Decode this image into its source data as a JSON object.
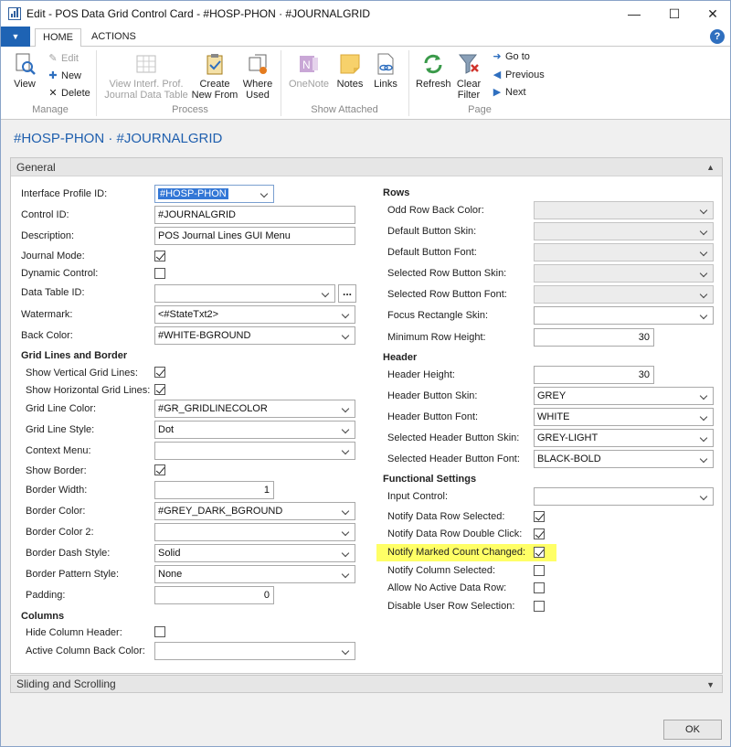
{
  "window": {
    "title": "Edit - POS Data Grid Control Card - #HOSP-PHON · #JOURNALGRID",
    "minimize": "—",
    "maximize": "☐",
    "close": "✕"
  },
  "ribbon_tabs": [
    "HOME",
    "ACTIONS"
  ],
  "ribbon": {
    "manage": {
      "label": "Manage",
      "view": "View",
      "edit": "Edit",
      "new": "New",
      "delete": "Delete"
    },
    "process": {
      "label": "Process",
      "view_interf": "View Interf. Prof.",
      "view_interf2": "Journal Data Table",
      "create": "Create",
      "create2": "New From",
      "where": "Where",
      "where2": "Used"
    },
    "show_attached": {
      "label": "Show Attached",
      "onenote": "OneNote",
      "notes": "Notes",
      "links": "Links"
    },
    "page": {
      "label": "Page",
      "refresh": "Refresh",
      "clear": "Clear",
      "clear2": "Filter",
      "goto": "Go to",
      "previous": "Previous",
      "next": "Next"
    }
  },
  "page_title": "#HOSP-PHON · #JOURNALGRID",
  "general": {
    "header": "General",
    "left": {
      "interface_profile_id": {
        "label": "Interface Profile ID:",
        "value": "#HOSP-PHON"
      },
      "control_id": {
        "label": "Control ID:",
        "value": "#JOURNALGRID"
      },
      "description": {
        "label": "Description:",
        "value": "POS Journal Lines GUI Menu"
      },
      "journal_mode": {
        "label": "Journal Mode:",
        "checked": true
      },
      "dynamic_control": {
        "label": "Dynamic Control:",
        "checked": false
      },
      "data_table_id": {
        "label": "Data Table ID:",
        "value": "",
        "button": "..."
      },
      "watermark": {
        "label": "Watermark:",
        "value": "<#StateTxt2>"
      },
      "back_color": {
        "label": "Back Color:",
        "value": "#WHITE-BGROUND"
      },
      "grid_section": "Grid Lines and Border",
      "show_vertical": {
        "label": "Show Vertical Grid Lines:",
        "checked": true
      },
      "show_horizontal": {
        "label": "Show Horizontal Grid Lines:",
        "checked": true
      },
      "grid_line_color": {
        "label": "Grid Line Color:",
        "value": "#GR_GRIDLINECOLOR"
      },
      "grid_line_style": {
        "label": "Grid Line Style:",
        "value": "Dot"
      },
      "context_menu": {
        "label": "Context Menu:",
        "value": ""
      },
      "show_border": {
        "label": "Show Border:",
        "checked": true
      },
      "border_width": {
        "label": "Border Width:",
        "value": "1"
      },
      "border_color": {
        "label": "Border Color:",
        "value": "#GREY_DARK_BGROUND"
      },
      "border_color2": {
        "label": "Border Color 2:",
        "value": ""
      },
      "border_dash_style": {
        "label": "Border Dash Style:",
        "value": "Solid"
      },
      "border_pattern_style": {
        "label": "Border Pattern Style:",
        "value": "None"
      },
      "padding": {
        "label": "Padding:",
        "value": "0"
      },
      "columns_section": "Columns",
      "hide_column_header": {
        "label": "Hide Column Header:",
        "checked": false
      },
      "active_column_back_color": {
        "label": "Active Column Back Color:",
        "value": ""
      }
    },
    "right": {
      "rows_section": "Rows",
      "odd_row_back_color": {
        "label": "Odd Row Back Color:",
        "value": ""
      },
      "default_button_skin": {
        "label": "Default Button Skin:",
        "value": ""
      },
      "default_button_font": {
        "label": "Default Button Font:",
        "value": ""
      },
      "selected_row_button_skin": {
        "label": "Selected Row Button Skin:",
        "value": ""
      },
      "selected_row_button_font": {
        "label": "Selected Row Button Font:",
        "value": ""
      },
      "focus_rectangle_skin": {
        "label": "Focus Rectangle Skin:",
        "value": ""
      },
      "minimum_row_height": {
        "label": "Minimum Row Height:",
        "value": "30"
      },
      "header_section": "Header",
      "header_height": {
        "label": "Header Height:",
        "value": "30"
      },
      "header_button_skin": {
        "label": "Header Button Skin:",
        "value": "GREY"
      },
      "header_button_font": {
        "label": "Header Button Font:",
        "value": "WHITE"
      },
      "selected_header_button_skin": {
        "label": "Selected Header Button Skin:",
        "value": "GREY-LIGHT"
      },
      "selected_header_button_font": {
        "label": "Selected Header Button Font:",
        "value": "BLACK-BOLD"
      },
      "functional_section": "Functional Settings",
      "input_control": {
        "label": "Input Control:",
        "value": ""
      },
      "notify_row_selected": {
        "label": "Notify Data Row Selected:",
        "checked": true
      },
      "notify_row_double_click": {
        "label": "Notify Data Row Double Click:",
        "checked": true
      },
      "notify_marked_count": {
        "label": "Notify Marked Count Changed:",
        "checked": true
      },
      "notify_column_selected": {
        "label": "Notify Column Selected:",
        "checked": false
      },
      "allow_no_active": {
        "label": "Allow No Active Data Row:",
        "checked": false
      },
      "disable_user_row_selection": {
        "label": "Disable User Row Selection:",
        "checked": false
      }
    }
  },
  "sliding": {
    "header": "Sliding and Scrolling"
  },
  "ok_button": "OK",
  "colors": {
    "accent": "#1f5fae",
    "highlight": "#ffff66",
    "selection": "#3377d6"
  }
}
